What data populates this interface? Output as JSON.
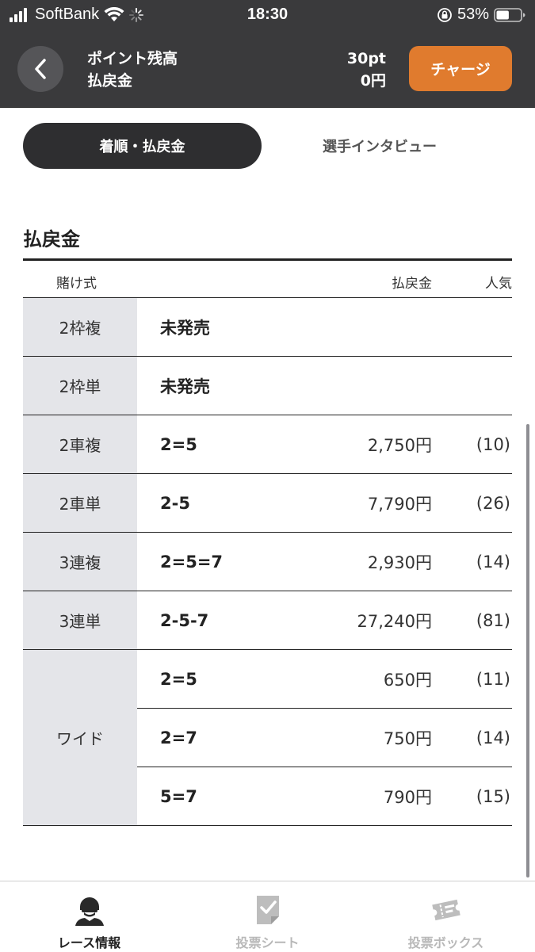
{
  "status_bar": {
    "carrier": "SoftBank",
    "time": "18:30",
    "battery": "53%",
    "battery_level": 0.53
  },
  "header": {
    "points_label": "ポイント残高",
    "refund_label": "払戻金",
    "points_value": "30pt",
    "refund_value": "0円",
    "charge_label": "チャージ"
  },
  "tabs": {
    "active": "着順・払戻金",
    "inactive": "選手インタビュー"
  },
  "payout": {
    "title": "払戻金",
    "headers": {
      "type": "賭け式",
      "payout": "払戻金",
      "popularity": "人気"
    },
    "rows": [
      {
        "type": "2枠複",
        "combo": "未発売",
        "payout": "",
        "popularity": ""
      },
      {
        "type": "2枠単",
        "combo": "未発売",
        "payout": "",
        "popularity": ""
      },
      {
        "type": "2車複",
        "combo": "2=5",
        "payout": "2,750円",
        "popularity": "(10)"
      },
      {
        "type": "2車単",
        "combo": "2-5",
        "payout": "7,790円",
        "popularity": "(26)"
      },
      {
        "type": "3連複",
        "combo": "2=5=7",
        "payout": "2,930円",
        "popularity": "(14)"
      },
      {
        "type": "3連単",
        "combo": "2-5-7",
        "payout": "27,240円",
        "popularity": "(81)"
      }
    ],
    "wide": {
      "type": "ワイド",
      "entries": [
        {
          "combo": "2=5",
          "payout": "650円",
          "popularity": "(11)"
        },
        {
          "combo": "2=7",
          "payout": "750円",
          "popularity": "(14)"
        },
        {
          "combo": "5=7",
          "payout": "790円",
          "popularity": "(15)"
        }
      ]
    }
  },
  "bottom_nav": [
    {
      "label": "レース情報",
      "icon": "rider-icon",
      "active": true
    },
    {
      "label": "投票シート",
      "icon": "vote-sheet-icon",
      "active": false
    },
    {
      "label": "投票ボックス",
      "icon": "ticket-box-icon",
      "active": false
    }
  ],
  "colors": {
    "header_bg": "#3a3a3c",
    "accent": "#e07b2e",
    "label_cell_bg": "#e4e5e9",
    "inactive_nav": "#b8b8b8"
  }
}
